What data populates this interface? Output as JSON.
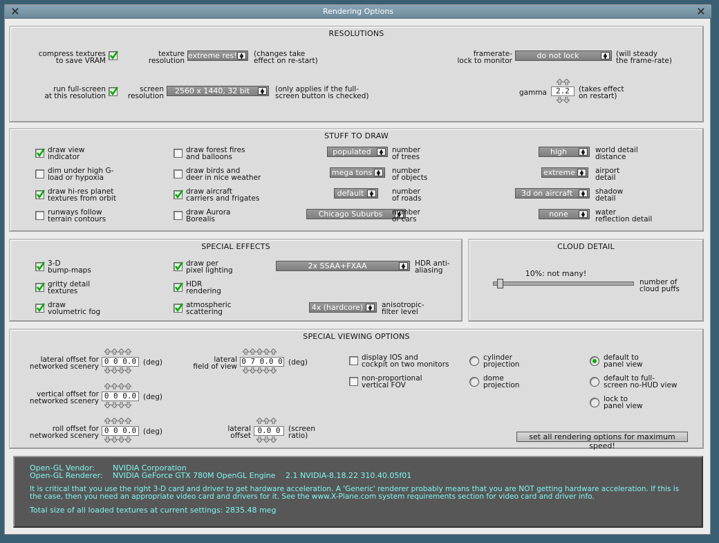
{
  "window": {
    "title": "Rendering Options",
    "close_left": "✕",
    "close_right": "✕"
  },
  "res": {
    "title": "RESOLUTIONS",
    "compress": "compress textures\nto save VRAM",
    "texres": "texture\nresolution",
    "texres_val": "extreme res!",
    "texres_note": "(changes take\neffect on re-start)",
    "framerate": "framerate-\nlock to monitor",
    "framerate_val": "do not lock",
    "framerate_note": "(will steady\nthe frame-rate)",
    "fullscreen": "run full-screen\nat this resolution",
    "screenres": "screen\nresolution",
    "screenres_val": "2560 x 1440, 32 bit",
    "screenres_note": "(only applies if the full-\nscreen button is checked)",
    "gamma": "gamma",
    "gamma_val": "2.2",
    "gamma_note": "(takes effect\non restart)"
  },
  "draw": {
    "title": "STUFF TO DRAW",
    "c1": [
      {
        "label": "draw view\nindicator",
        "on": true
      },
      {
        "label": "dim under high G-\nload or hypoxia",
        "on": false
      },
      {
        "label": "draw hi-res planet\ntextures from orbit",
        "on": true
      },
      {
        "label": "runways follow\nterrain contours",
        "on": false
      }
    ],
    "c2": [
      {
        "label": "draw forest fires\nand balloons",
        "on": false
      },
      {
        "label": "draw birds and\ndeer in nice weather",
        "on": false
      },
      {
        "label": "draw aircraft\ncarriers and frigates",
        "on": true
      },
      {
        "label": "draw Aurora\nBorealis",
        "on": false
      }
    ],
    "c3": [
      {
        "val": "populated",
        "label": "number\nof trees"
      },
      {
        "val": "mega tons",
        "label": "number\nof objects"
      },
      {
        "val": "default",
        "label": "number\nof roads"
      },
      {
        "val": "Chicago Suburbs",
        "label": "number\nof cars"
      }
    ],
    "c4": [
      {
        "val": "high",
        "label": "world detail\ndistance"
      },
      {
        "val": "extreme",
        "label": "airport\ndetail"
      },
      {
        "val": "3d on aircraft",
        "label": "shadow\ndetail"
      },
      {
        "val": "none",
        "label": "water\nreflection detail"
      }
    ]
  },
  "fx": {
    "title": "SPECIAL EFFECTS",
    "c1": [
      {
        "label": "3-D\nbump-maps",
        "on": true
      },
      {
        "label": "gritty detail\ntextures",
        "on": true
      },
      {
        "label": "draw\nvolumetric fog",
        "on": true
      }
    ],
    "c2": [
      {
        "label": "draw per\npixel lighting",
        "on": true
      },
      {
        "label": "HDR\nrendering",
        "on": true
      },
      {
        "label": "atmospheric\nscattering",
        "on": true
      }
    ],
    "aa_val": "2x SSAA+FXAA",
    "aa_label": "HDR anti-\naliasing",
    "aniso_val": "4x (hardcore)",
    "aniso_label": "anisotropic-\nfilter level"
  },
  "cloud": {
    "title": "CLOUD DETAIL",
    "value_text": "10%: not many!",
    "label": "number of\ncloud puffs",
    "level": 0.1
  },
  "view": {
    "title": "SPECIAL VIEWING OPTIONS",
    "lat": "lateral offset for\nnetworked scenery",
    "lat_val": "0 0 0.0",
    "vert": "vertical offset for\nnetworked scenery",
    "vert_val": "0 0 0.0",
    "roll": "roll offset for\nnetworked scenery",
    "roll_val": "0 0 0.0",
    "deg": "(deg)",
    "fov": "lateral\nfield of view",
    "fov_val": "0 7 0.0 0",
    "fov_unit": "(deg)",
    "latoff": "lateral\noffset",
    "latoff_val": "0.0 0",
    "latoff_unit": "(screen\nratio)",
    "ios": "display IOS and\ncockpit on two monitors",
    "ios_on": false,
    "nonprop": "non-proportional\nvertical FOV",
    "nonprop_on": false,
    "cyl": "cylinder\nprojection",
    "dome": "dome\nprojection",
    "panel": "default to\npanel view",
    "full": "default to full-\nscreen no-HUD view",
    "lock": "lock to\npanel view",
    "maxbtn": "set all rendering options for maximum speed!"
  },
  "info": {
    "vendor_k": "Open-GL Vendor:",
    "vendor_v": "NVIDIA Corporation",
    "renderer_k": "Open-GL Renderer:",
    "renderer_v": "NVIDIA GeForce GTX 780M OpenGL Engine",
    "version": "2.1 NVIDIA-8.18.22 310.40.05f01",
    "warn": "It is critical that you use the right 3-D card and driver to get hardware acceleration. A 'Generic' renderer probably means that you are NOT getting hardware acceleration. If this is\nthe case, then you need an appropriate video card and drivers for it. See the www.X-Plane.com system requirements section for video card and driver info.",
    "total": "Total size of all loaded textures at current settings: 2835.48 meg"
  },
  "colors": {
    "info_text": "#7ff6f0",
    "check": "#00a000"
  }
}
